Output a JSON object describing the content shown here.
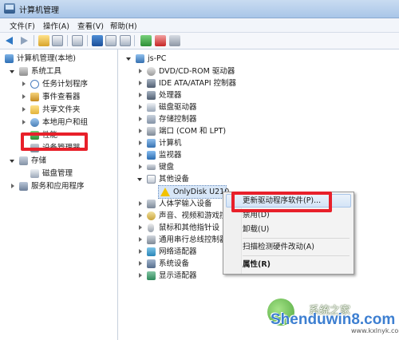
{
  "window": {
    "title": "计算机管理"
  },
  "menubar": [
    "文件(F)",
    "操作(A)",
    "查看(V)",
    "帮助(H)"
  ],
  "left_tree": {
    "root": "计算机管理(本地)",
    "system_tools": "系统工具",
    "system_children": [
      "任务计划程序",
      "事件查看器",
      "共享文件夹",
      "本地用户和组",
      "性能",
      "设备管理器"
    ],
    "storage": "存储",
    "storage_children": [
      "磁盘管理"
    ],
    "services": "服务和应用程序"
  },
  "right_tree": {
    "root": "js-PC",
    "categories": [
      "DVD/CD-ROM 驱动器",
      "IDE ATA/ATAPI 控制器",
      "处理器",
      "磁盘驱动器",
      "存储控制器",
      "端口 (COM 和 LPT)",
      "计算机",
      "监视器",
      "键盘",
      "其他设备"
    ],
    "other_device_child": "OnlyDisk U210",
    "after_categories": [
      "人体学输入设备",
      "声音、视频和游戏控",
      "鼠标和其他指针设",
      "通用串行总线控制器",
      "网络适配器",
      "系统设备",
      "显示适配器"
    ]
  },
  "context_menu": {
    "items": [
      {
        "label": "更新驱动程序软件(P)...",
        "bold": false
      },
      {
        "label": "禁用(D)",
        "bold": false
      },
      {
        "label": "卸载(U)",
        "bold": false
      },
      {
        "label": "扫描检测硬件改动(A)",
        "bold": false
      },
      {
        "label": "属性(R)",
        "bold": true
      }
    ]
  },
  "watermark": {
    "cn": "系统之家",
    "domain": "Shenduwin8.com",
    "url": "www.kxlnyk.com"
  },
  "colors": {
    "highlight_box": "#e8202a",
    "warning": "#f2c200"
  }
}
